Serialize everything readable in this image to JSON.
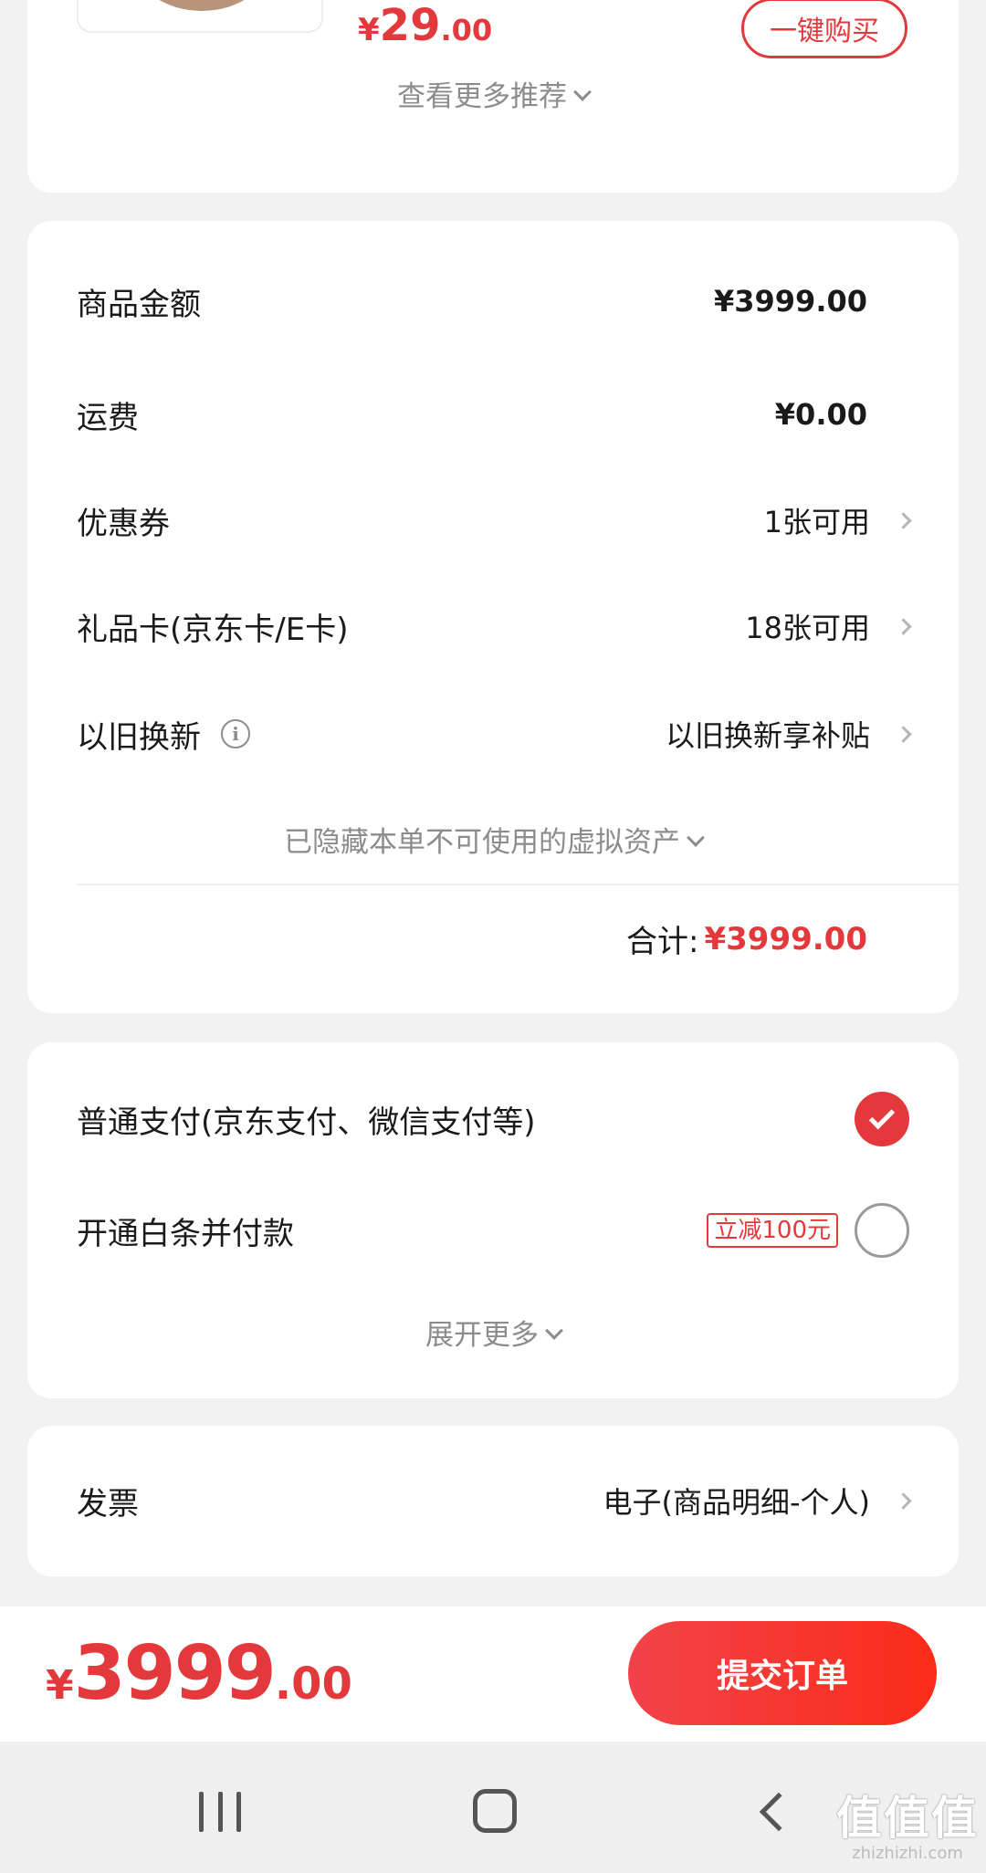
{
  "recommendation": {
    "price_symbol": "¥",
    "price_int": "29",
    "price_dec": ".00",
    "buy_label": "一键购买",
    "see_more_label": "查看更多推荐"
  },
  "amounts": {
    "goods_label": "商品金额",
    "goods_value": "¥3999.00",
    "shipping_label": "运费",
    "shipping_value": "¥0.00",
    "coupon_label": "优惠券",
    "coupon_value": "1张可用",
    "giftcard_label": "礼品卡(京东卡/E卡)",
    "giftcard_value": "18张可用",
    "tradein_label": "以旧换新",
    "tradein_value": "以旧换新享补贴",
    "hidden_note": "已隐藏本单不可使用的虚拟资产",
    "total_label": "合计:",
    "total_value": "¥3999.00"
  },
  "payment": {
    "normal_label": "普通支付(京东支付、微信支付等)",
    "baitiao_label": "开通白条并付款",
    "baitiao_promo": "立减100元",
    "expand_label": "展开更多",
    "normal_selected": true,
    "baitiao_selected": false
  },
  "invoice": {
    "label": "发票",
    "value": "电子(商品明细-个人)"
  },
  "bottom": {
    "price_symbol": "¥",
    "price_int": "3999",
    "price_dec": ".00",
    "submit_label": "提交订单"
  },
  "watermark": {
    "main": "值值值",
    "sub": "zhizhizhi.com"
  },
  "colors": {
    "accent": "#e4393c",
    "background": "#f2f2f2"
  },
  "icons": [
    "chevron-down-icon",
    "chevron-right-icon",
    "info-icon",
    "check-icon",
    "recent-apps-icon",
    "home-icon",
    "back-icon"
  ]
}
